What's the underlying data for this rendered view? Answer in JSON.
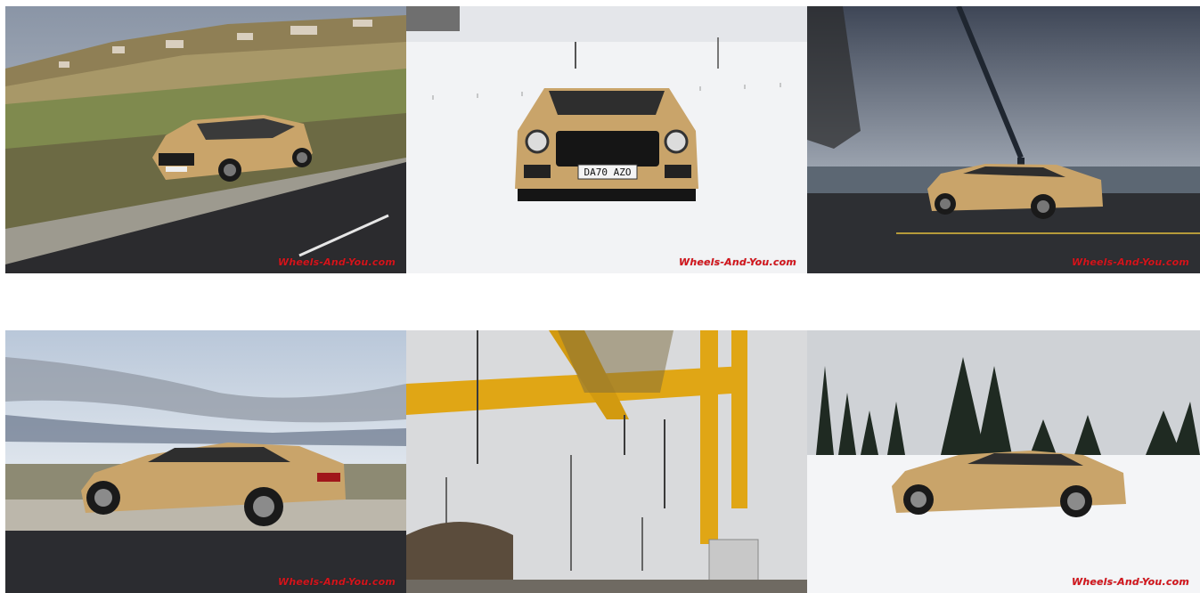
{
  "watermark": "Wheels-And-You.com",
  "photos": [
    {
      "subject": "gold sedan on hillside road among vineyards"
    },
    {
      "subject": "gold sedan front view in snow",
      "plate": "DA70 AZO"
    },
    {
      "subject": "gold sedan by the lake with crane under cloudy sky"
    },
    {
      "subject": "gold sedan side view by vineyards under clouds"
    },
    {
      "subject": "yellow gantry crane and power lines"
    },
    {
      "subject": "gold sedan in snowy forest"
    }
  ],
  "colors": {
    "car_gold": "#c9a46a",
    "watermark_red": "#d4141b"
  }
}
